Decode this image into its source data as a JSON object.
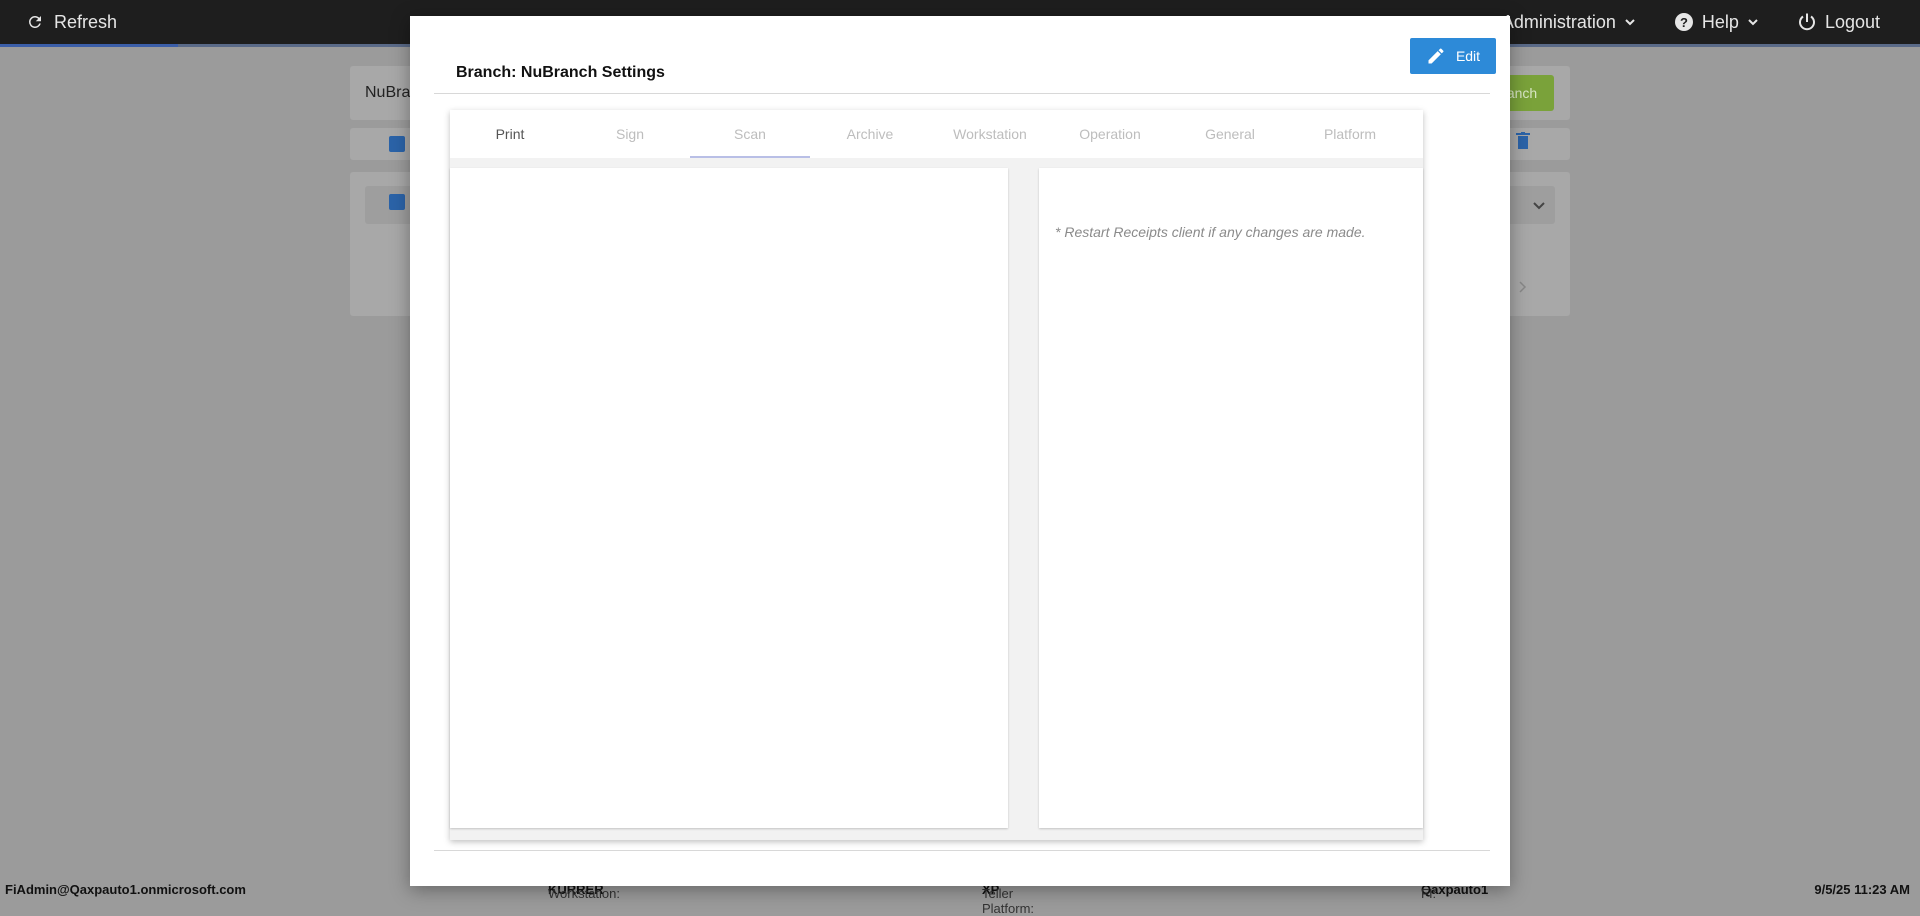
{
  "topbar": {
    "refresh_label": "Refresh",
    "administration_label": "Administration",
    "help_label": "Help",
    "logout_label": "Logout"
  },
  "background": {
    "search_value": "NuBra",
    "green_button_label": "anch"
  },
  "modal": {
    "title": "Branch: NuBranch Settings",
    "edit_label": "Edit",
    "tabs": [
      {
        "label": "Print"
      },
      {
        "label": "Sign"
      },
      {
        "label": "Scan"
      },
      {
        "label": "Archive"
      },
      {
        "label": "Workstation"
      },
      {
        "label": "Operation"
      },
      {
        "label": "General"
      },
      {
        "label": "Platform"
      }
    ],
    "active_tab": "Scan",
    "note": "* Restart Receipts client if any changes are made."
  },
  "footer": {
    "user": "FiAdmin@Qaxpauto1.onmicrosoft.com",
    "workstation_label": "Workstation:",
    "workstation_value": "KURRER",
    "teller_label": "Teller Platform:",
    "teller_value": "XP",
    "fi_label": "FI:",
    "fi_value": "Qaxpauto1",
    "datetime": "9/5/25 11:23 AM"
  },
  "colors": {
    "topbar": "#1e1e1e",
    "overlay": "#9b9b9b",
    "edit_button": "#2d8ad8",
    "active_tab_underline": "#b9bfe6"
  }
}
